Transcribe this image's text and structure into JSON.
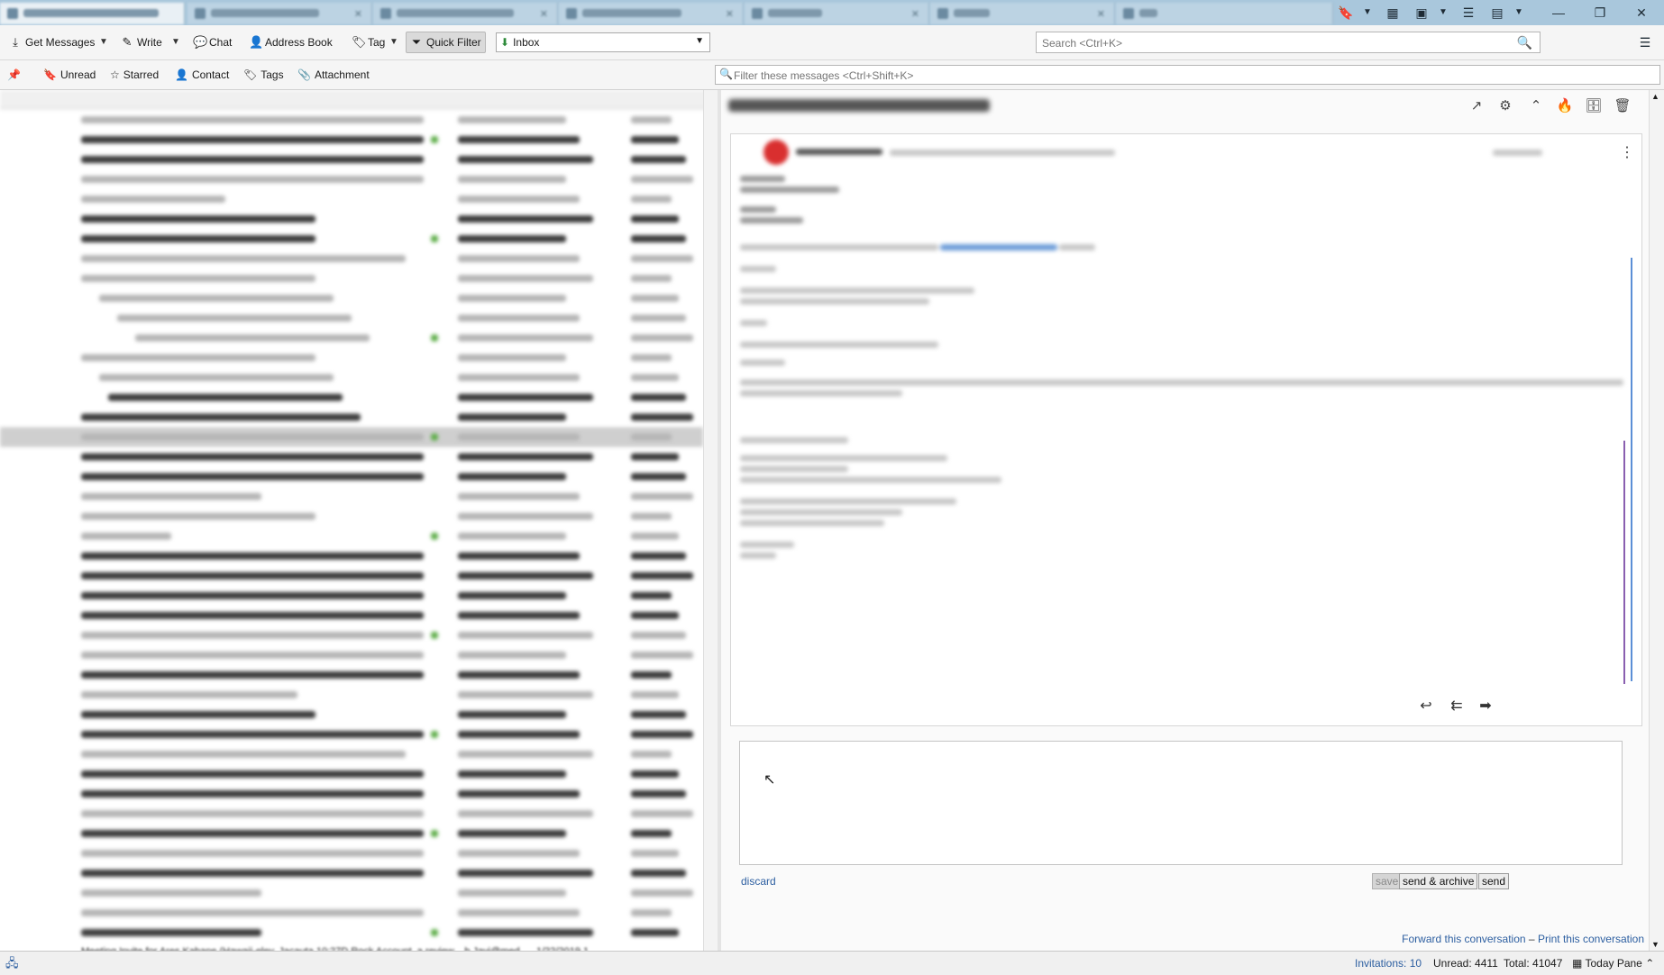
{
  "toolbar": {
    "get_messages": "Get Messages",
    "write": "Write",
    "chat": "Chat",
    "address_book": "Address Book",
    "tag": "Tag",
    "quick_filter": "Quick Filter",
    "folder": "Inbox",
    "search_placeholder": "Search <Ctrl+K>"
  },
  "quick_filter_bar": {
    "unread": "Unread",
    "starred": "Starred",
    "contact": "Contact",
    "tags": "Tags",
    "attachment": "Attachment",
    "filter_placeholder": "Filter these messages <Ctrl+Shift+K>"
  },
  "thread_pane": {
    "peek_text": "Meeting Invite for Ares Kabane (Hawaii-eley, Jacauta 10:27D Rock Account, a review... b Jayj@med...",
    "peek_date": "1/22/2019 1"
  },
  "reply": {
    "discard": "discard",
    "save": "save",
    "send_archive": "send & archive",
    "send": "send"
  },
  "footer": {
    "forward": "Forward this conversation",
    "separator": "–",
    "print": "Print this conversation"
  },
  "status": {
    "invitations": "Invitations: 10",
    "unread": "Unread: 4411",
    "total": "Total: 41047",
    "today_pane": "Today Pane"
  },
  "colors": {
    "accent": "#2c5ea0",
    "tabstrip": "#a9c7dc",
    "avatar": "#d92f2f"
  }
}
